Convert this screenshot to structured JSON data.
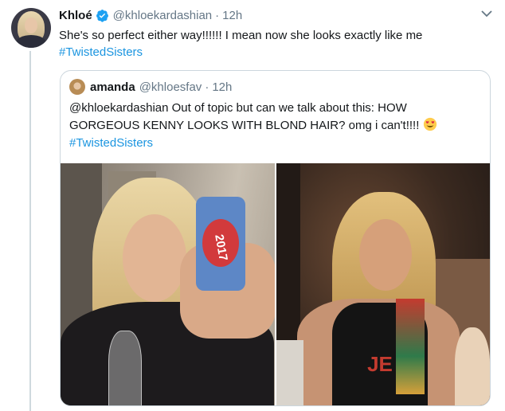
{
  "tweet": {
    "name": "Khloé",
    "handle": "@khloekardashian",
    "separator": "·",
    "time": "12h",
    "text": "She's so perfect either way!!!!!! I mean now she looks exactly like me",
    "hashtag": "#TwistedSisters",
    "accent_color": "#1b95e0"
  },
  "quoted_tweet": {
    "name": "amanda",
    "handle": "@khloesfav",
    "separator": "·",
    "time": "12h",
    "text": "@khloekardashian Out of topic but can we talk about this: HOW GORGEOUS KENNY LOOKS WITH BLOND HAIR? omg i can't!!!!",
    "emoji": "heart-eyes-emoji",
    "hashtag": "#TwistedSisters",
    "images": [
      {
        "name": "mirror-selfie-photo",
        "case_text": "2017"
      },
      {
        "name": "seated-portrait-photo",
        "shirt_text": "JE"
      }
    ]
  },
  "icons": {
    "verified": "verified-badge-icon",
    "menu": "chevron-down-icon"
  }
}
